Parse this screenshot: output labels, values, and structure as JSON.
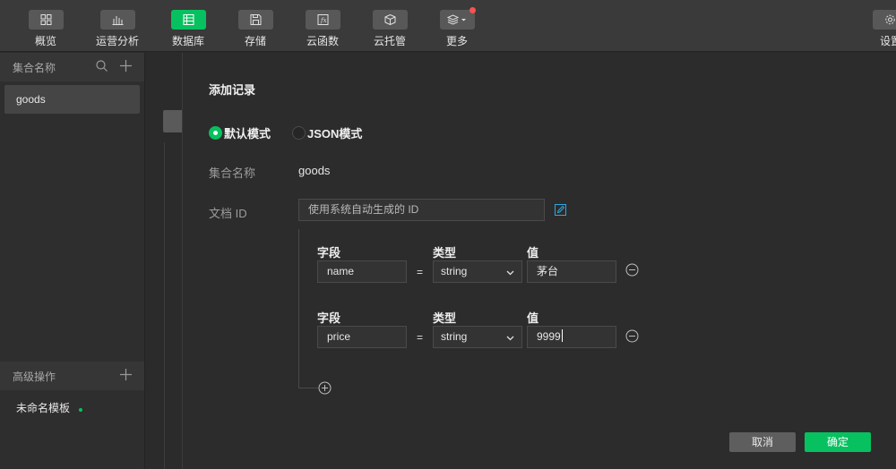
{
  "toolbar": {
    "items": [
      {
        "label": "概览",
        "icon": "grid-icon"
      },
      {
        "label": "运营分析",
        "icon": "bar-chart-icon"
      },
      {
        "label": "数据库",
        "icon": "database-icon"
      },
      {
        "label": "存储",
        "icon": "floppy-disk-icon"
      },
      {
        "label": "云函数",
        "icon": "function-icon"
      },
      {
        "label": "云托管",
        "icon": "cube-icon"
      },
      {
        "label": "更多",
        "icon": "layers-icon"
      },
      {
        "label": "设置",
        "icon": "gear-icon"
      }
    ],
    "active": "数据库",
    "accent": "#07c160",
    "badge_color": "#fa5151"
  },
  "sidebar": {
    "collections_header": "集合名称",
    "collections": [
      "goods"
    ],
    "advanced_header": "高级操作",
    "templates": [
      "未命名模板"
    ]
  },
  "dialog": {
    "title": "添加记录",
    "modes": [
      {
        "label": "默认模式",
        "checked": true
      },
      {
        "label": "JSON模式",
        "checked": false
      }
    ],
    "collection_label": "集合名称",
    "collection_value": "goods",
    "doc_id_label": "文档 ID",
    "doc_id_placeholder": "使用系统自动生成的 ID",
    "field_header": "字段",
    "type_header": "类型",
    "value_header": "值",
    "equals": "=",
    "fields": [
      {
        "name": "name",
        "type": "string",
        "value": "茅台"
      },
      {
        "name": "price",
        "type": "string",
        "value": "9999"
      }
    ],
    "cancel_label": "取消",
    "confirm_label": "确定"
  }
}
